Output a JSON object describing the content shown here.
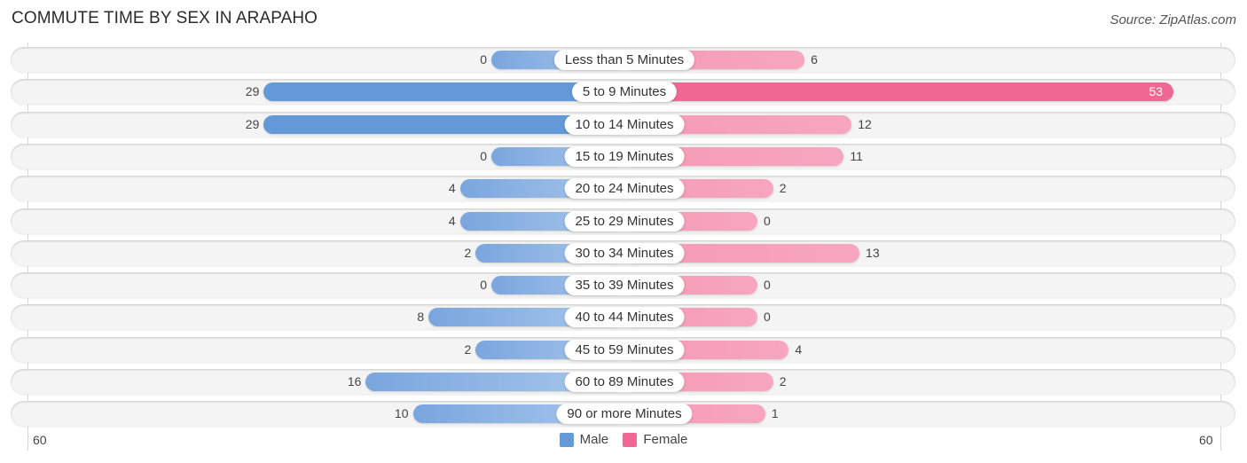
{
  "header": {
    "title": "COMMUTE TIME BY SEX IN ARAPAHO",
    "source": "Source: ZipAtlas.com"
  },
  "colors": {
    "male": "#6499d8",
    "female": "#f06892",
    "male_light": "#a9c8ec",
    "female_light": "#f7a6be"
  },
  "chart_data": {
    "type": "bar",
    "orientation": "horizontal-diverging",
    "title": "COMMUTE TIME BY SEX IN ARAPAHO",
    "categories": [
      "Less than 5 Minutes",
      "5 to 9 Minutes",
      "10 to 14 Minutes",
      "15 to 19 Minutes",
      "20 to 24 Minutes",
      "25 to 29 Minutes",
      "30 to 34 Minutes",
      "35 to 39 Minutes",
      "40 to 44 Minutes",
      "45 to 59 Minutes",
      "60 to 89 Minutes",
      "90 or more Minutes"
    ],
    "series": [
      {
        "name": "Male",
        "values": [
          0,
          29,
          29,
          0,
          4,
          4,
          2,
          0,
          8,
          2,
          16,
          10
        ]
      },
      {
        "name": "Female",
        "values": [
          6,
          53,
          12,
          11,
          2,
          0,
          13,
          0,
          0,
          4,
          2,
          1
        ]
      }
    ],
    "axis": {
      "left_label": "60",
      "right_label": "60",
      "range": [
        -60,
        60
      ]
    },
    "legend": {
      "position": "bottom-center",
      "entries": [
        "Male",
        "Female"
      ]
    },
    "xlabel": "",
    "ylabel": ""
  }
}
